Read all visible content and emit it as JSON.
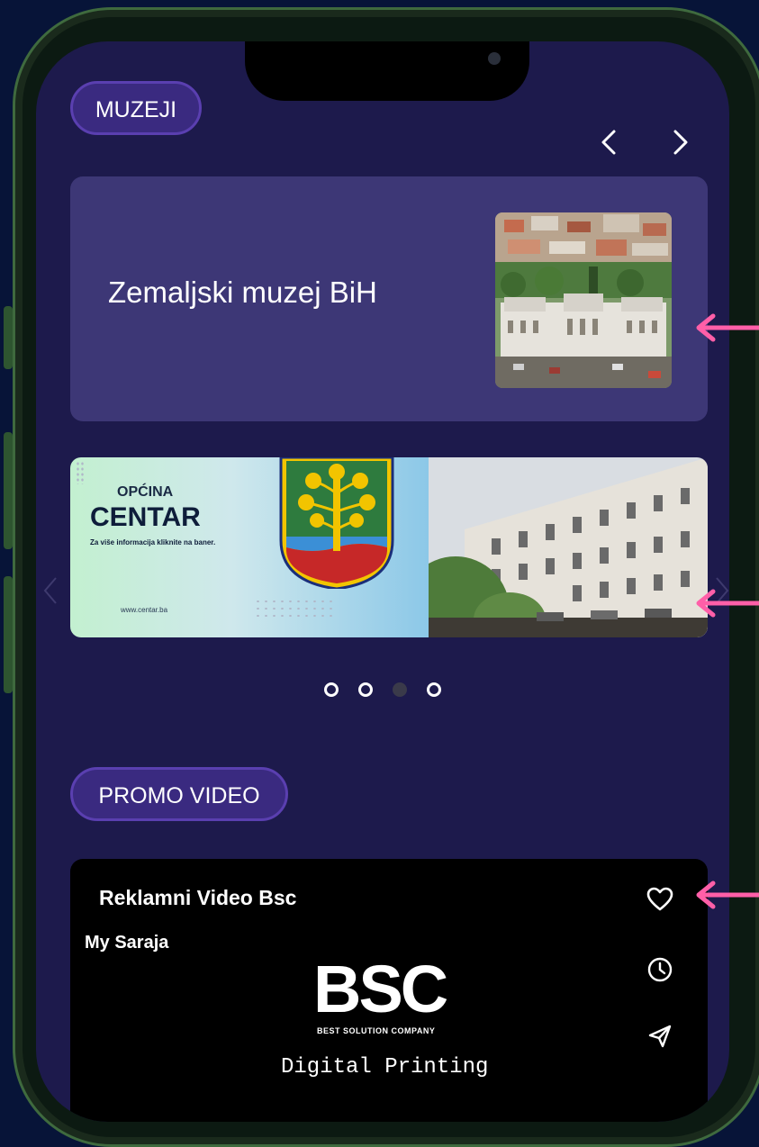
{
  "museums": {
    "section_label": "MUZEJI",
    "featured": {
      "title": "Zemaljski muzej BiH"
    }
  },
  "banner": {
    "municipality_small": "OPĆINA",
    "municipality_big": "CENTAR",
    "info": "Za više informacija kliknite na baner.",
    "url": "www.centar.ba",
    "slides_total": 4,
    "active_slide": 3
  },
  "promo": {
    "section_label": "PROMO VIDEO",
    "video_title": "Reklamni Video Bsc",
    "channel": "My Saraja",
    "logo_text": "BSC",
    "logo_tagline": "BEST SOLUTION COMPANY",
    "caption": "Digital Printing"
  },
  "icons": {
    "prev": "chevron-left-icon",
    "next": "chevron-right-icon",
    "like": "heart-icon",
    "watch_later": "clock-icon",
    "share": "send-icon",
    "annotation": "arrow-left-icon"
  },
  "colors": {
    "background": "#071438",
    "screen": "#1d1a4c",
    "pill": "#3a2a80",
    "card": "#3d3776",
    "annotation": "#ff5fa8"
  }
}
